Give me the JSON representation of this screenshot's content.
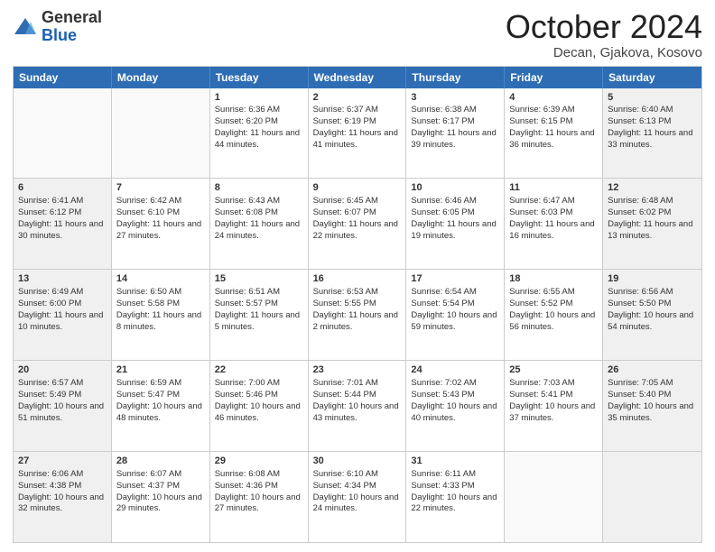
{
  "logo": {
    "general": "General",
    "blue": "Blue"
  },
  "title": "October 2024",
  "location": "Decan, Gjakova, Kosovo",
  "days": [
    "Sunday",
    "Monday",
    "Tuesday",
    "Wednesday",
    "Thursday",
    "Friday",
    "Saturday"
  ],
  "weeks": [
    [
      {
        "day": "",
        "info": "",
        "empty": true
      },
      {
        "day": "",
        "info": "",
        "empty": true
      },
      {
        "day": "1",
        "info": "Sunrise: 6:36 AM\nSunset: 6:20 PM\nDaylight: 11 hours and 44 minutes."
      },
      {
        "day": "2",
        "info": "Sunrise: 6:37 AM\nSunset: 6:19 PM\nDaylight: 11 hours and 41 minutes."
      },
      {
        "day": "3",
        "info": "Sunrise: 6:38 AM\nSunset: 6:17 PM\nDaylight: 11 hours and 39 minutes."
      },
      {
        "day": "4",
        "info": "Sunrise: 6:39 AM\nSunset: 6:15 PM\nDaylight: 11 hours and 36 minutes."
      },
      {
        "day": "5",
        "info": "Sunrise: 6:40 AM\nSunset: 6:13 PM\nDaylight: 11 hours and 33 minutes."
      }
    ],
    [
      {
        "day": "6",
        "info": "Sunrise: 6:41 AM\nSunset: 6:12 PM\nDaylight: 11 hours and 30 minutes."
      },
      {
        "day": "7",
        "info": "Sunrise: 6:42 AM\nSunset: 6:10 PM\nDaylight: 11 hours and 27 minutes."
      },
      {
        "day": "8",
        "info": "Sunrise: 6:43 AM\nSunset: 6:08 PM\nDaylight: 11 hours and 24 minutes."
      },
      {
        "day": "9",
        "info": "Sunrise: 6:45 AM\nSunset: 6:07 PM\nDaylight: 11 hours and 22 minutes."
      },
      {
        "day": "10",
        "info": "Sunrise: 6:46 AM\nSunset: 6:05 PM\nDaylight: 11 hours and 19 minutes."
      },
      {
        "day": "11",
        "info": "Sunrise: 6:47 AM\nSunset: 6:03 PM\nDaylight: 11 hours and 16 minutes."
      },
      {
        "day": "12",
        "info": "Sunrise: 6:48 AM\nSunset: 6:02 PM\nDaylight: 11 hours and 13 minutes."
      }
    ],
    [
      {
        "day": "13",
        "info": "Sunrise: 6:49 AM\nSunset: 6:00 PM\nDaylight: 11 hours and 10 minutes."
      },
      {
        "day": "14",
        "info": "Sunrise: 6:50 AM\nSunset: 5:58 PM\nDaylight: 11 hours and 8 minutes."
      },
      {
        "day": "15",
        "info": "Sunrise: 6:51 AM\nSunset: 5:57 PM\nDaylight: 11 hours and 5 minutes."
      },
      {
        "day": "16",
        "info": "Sunrise: 6:53 AM\nSunset: 5:55 PM\nDaylight: 11 hours and 2 minutes."
      },
      {
        "day": "17",
        "info": "Sunrise: 6:54 AM\nSunset: 5:54 PM\nDaylight: 10 hours and 59 minutes."
      },
      {
        "day": "18",
        "info": "Sunrise: 6:55 AM\nSunset: 5:52 PM\nDaylight: 10 hours and 56 minutes."
      },
      {
        "day": "19",
        "info": "Sunrise: 6:56 AM\nSunset: 5:50 PM\nDaylight: 10 hours and 54 minutes."
      }
    ],
    [
      {
        "day": "20",
        "info": "Sunrise: 6:57 AM\nSunset: 5:49 PM\nDaylight: 10 hours and 51 minutes."
      },
      {
        "day": "21",
        "info": "Sunrise: 6:59 AM\nSunset: 5:47 PM\nDaylight: 10 hours and 48 minutes."
      },
      {
        "day": "22",
        "info": "Sunrise: 7:00 AM\nSunset: 5:46 PM\nDaylight: 10 hours and 46 minutes."
      },
      {
        "day": "23",
        "info": "Sunrise: 7:01 AM\nSunset: 5:44 PM\nDaylight: 10 hours and 43 minutes."
      },
      {
        "day": "24",
        "info": "Sunrise: 7:02 AM\nSunset: 5:43 PM\nDaylight: 10 hours and 40 minutes."
      },
      {
        "day": "25",
        "info": "Sunrise: 7:03 AM\nSunset: 5:41 PM\nDaylight: 10 hours and 37 minutes."
      },
      {
        "day": "26",
        "info": "Sunrise: 7:05 AM\nSunset: 5:40 PM\nDaylight: 10 hours and 35 minutes."
      }
    ],
    [
      {
        "day": "27",
        "info": "Sunrise: 6:06 AM\nSunset: 4:38 PM\nDaylight: 10 hours and 32 minutes."
      },
      {
        "day": "28",
        "info": "Sunrise: 6:07 AM\nSunset: 4:37 PM\nDaylight: 10 hours and 29 minutes."
      },
      {
        "day": "29",
        "info": "Sunrise: 6:08 AM\nSunset: 4:36 PM\nDaylight: 10 hours and 27 minutes."
      },
      {
        "day": "30",
        "info": "Sunrise: 6:10 AM\nSunset: 4:34 PM\nDaylight: 10 hours and 24 minutes."
      },
      {
        "day": "31",
        "info": "Sunrise: 6:11 AM\nSunset: 4:33 PM\nDaylight: 10 hours and 22 minutes."
      },
      {
        "day": "",
        "info": "",
        "empty": true
      },
      {
        "day": "",
        "info": "",
        "empty": true
      }
    ]
  ]
}
